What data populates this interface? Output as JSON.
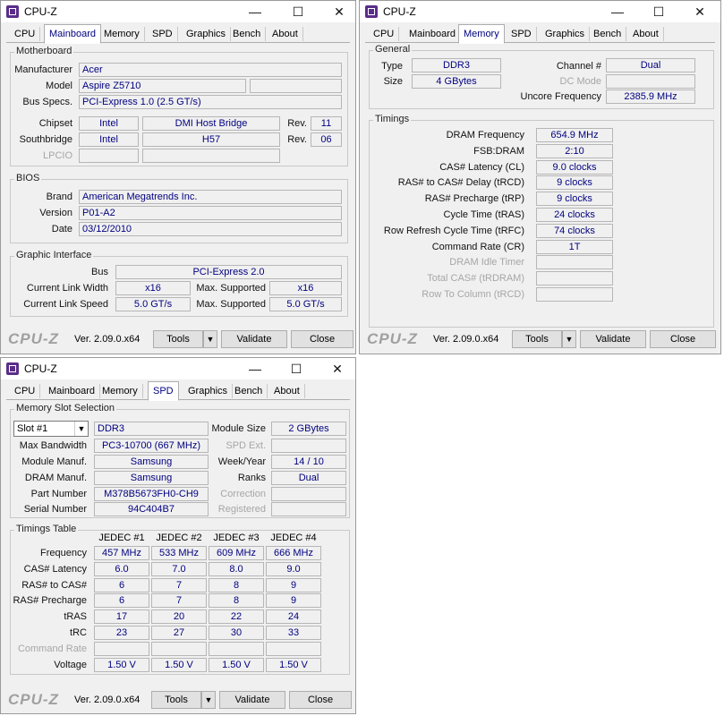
{
  "app": {
    "title": "CPU-Z",
    "logo": "CPU-Z",
    "version": "Ver. 2.09.0.x64"
  },
  "tabs": [
    "CPU",
    "Mainboard",
    "Memory",
    "SPD",
    "Graphics",
    "Bench",
    "About"
  ],
  "buttons": {
    "tools": "Tools",
    "validate": "Validate",
    "close": "Close",
    "dropdown": "▼"
  },
  "titlebar_glyphs": {
    "minimize": "—",
    "maximize": "☐",
    "close": "✕"
  },
  "mainboard": {
    "motherboard": {
      "title": "Motherboard",
      "manufacturer_label": "Manufacturer",
      "manufacturer": "Acer",
      "model_label": "Model",
      "model": "Aspire Z5710",
      "model_extra": "",
      "busspecs_label": "Bus Specs.",
      "busspecs": "PCI-Express 1.0 (2.5 GT/s)",
      "chipset_label": "Chipset",
      "chipset_vendor": "Intel",
      "chipset_name": "DMI Host Bridge",
      "chipset_rev_label": "Rev.",
      "chipset_rev": "11",
      "southbridge_label": "Southbridge",
      "southbridge_vendor": "Intel",
      "southbridge_name": "H57",
      "southbridge_rev_label": "Rev.",
      "southbridge_rev": "06",
      "lpcio_label": "LPCIO",
      "lpcio_vendor": "",
      "lpcio_name": ""
    },
    "bios": {
      "title": "BIOS",
      "brand_label": "Brand",
      "brand": "American Megatrends Inc.",
      "version_label": "Version",
      "version": "P01-A2",
      "date_label": "Date",
      "date": "03/12/2010"
    },
    "graphic": {
      "title": "Graphic Interface",
      "bus_label": "Bus",
      "bus": "PCI-Express 2.0",
      "width_label": "Current Link Width",
      "width": "x16",
      "width_max_label": "Max. Supported",
      "width_max": "x16",
      "speed_label": "Current Link Speed",
      "speed": "5.0 GT/s",
      "speed_max_label": "Max. Supported",
      "speed_max": "5.0 GT/s"
    }
  },
  "memory": {
    "general": {
      "title": "General",
      "type_label": "Type",
      "type": "DDR3",
      "size_label": "Size",
      "size": "4 GBytes",
      "channel_label": "Channel #",
      "channel": "Dual",
      "dcmode_label": "DC Mode",
      "dcmode": "",
      "uncore_label": "Uncore Frequency",
      "uncore": "2385.9 MHz"
    },
    "timings": {
      "title": "Timings",
      "rows": [
        {
          "label": "DRAM Frequency",
          "value": "654.9 MHz",
          "disabled": false
        },
        {
          "label": "FSB:DRAM",
          "value": "2:10",
          "disabled": false
        },
        {
          "label": "CAS# Latency (CL)",
          "value": "9.0 clocks",
          "disabled": false
        },
        {
          "label": "RAS# to CAS# Delay (tRCD)",
          "value": "9 clocks",
          "disabled": false
        },
        {
          "label": "RAS# Precharge (tRP)",
          "value": "9 clocks",
          "disabled": false
        },
        {
          "label": "Cycle Time (tRAS)",
          "value": "24 clocks",
          "disabled": false
        },
        {
          "label": "Row Refresh Cycle Time (tRFC)",
          "value": "74 clocks",
          "disabled": false
        },
        {
          "label": "Command Rate (CR)",
          "value": "1T",
          "disabled": false
        },
        {
          "label": "DRAM Idle Timer",
          "value": "",
          "disabled": true
        },
        {
          "label": "Total CAS# (tRDRAM)",
          "value": "",
          "disabled": true
        },
        {
          "label": "Row To Column (tRCD)",
          "value": "",
          "disabled": true
        }
      ]
    }
  },
  "spd": {
    "slot": {
      "title": "Memory Slot Selection",
      "selected": "Slot #1",
      "type": "DDR3",
      "module_size_label": "Module Size",
      "module_size": "2 GBytes",
      "max_bw_label": "Max Bandwidth",
      "max_bw": "PC3-10700 (667 MHz)",
      "spd_ext_label": "SPD Ext.",
      "spd_ext": "",
      "module_manuf_label": "Module Manuf.",
      "module_manuf": "Samsung",
      "weekyear_label": "Week/Year",
      "weekyear": "14 / 10",
      "dram_manuf_label": "DRAM Manuf.",
      "dram_manuf": "Samsung",
      "ranks_label": "Ranks",
      "ranks": "Dual",
      "part_label": "Part Number",
      "part": "M378B5673FH0-CH9",
      "correction_label": "Correction",
      "correction": "",
      "serial_label": "Serial Number",
      "serial": "94C404B7",
      "registered_label": "Registered",
      "registered": ""
    },
    "table": {
      "title": "Timings Table",
      "headers": [
        "JEDEC #1",
        "JEDEC #2",
        "JEDEC #3",
        "JEDEC #4"
      ],
      "rows": [
        {
          "label": "Frequency",
          "values": [
            "457 MHz",
            "533 MHz",
            "609 MHz",
            "666 MHz"
          ],
          "disabled": false
        },
        {
          "label": "CAS# Latency",
          "values": [
            "6.0",
            "7.0",
            "8.0",
            "9.0"
          ],
          "disabled": false
        },
        {
          "label": "RAS# to CAS#",
          "values": [
            "6",
            "7",
            "8",
            "9"
          ],
          "disabled": false
        },
        {
          "label": "RAS# Precharge",
          "values": [
            "6",
            "7",
            "8",
            "9"
          ],
          "disabled": false
        },
        {
          "label": "tRAS",
          "values": [
            "17",
            "20",
            "22",
            "24"
          ],
          "disabled": false
        },
        {
          "label": "tRC",
          "values": [
            "23",
            "27",
            "30",
            "33"
          ],
          "disabled": false
        },
        {
          "label": "Command Rate",
          "values": [
            "",
            "",
            "",
            ""
          ],
          "disabled": true
        },
        {
          "label": "Voltage",
          "values": [
            "1.50 V",
            "1.50 V",
            "1.50 V",
            "1.50 V"
          ],
          "disabled": false
        }
      ]
    }
  }
}
